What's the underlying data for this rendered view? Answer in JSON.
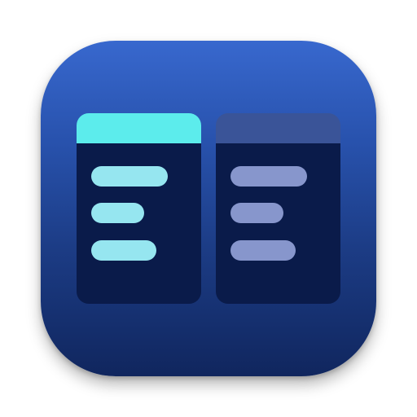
{
  "icon": {
    "colors": {
      "background_top": "#3868ce",
      "background_bottom": "#10265e",
      "column_body": "#0a1b4a",
      "left_header": "#5cecec",
      "left_lines": "#96e6f0",
      "right_header": "#3a5498",
      "right_lines": "#8796cc"
    }
  }
}
